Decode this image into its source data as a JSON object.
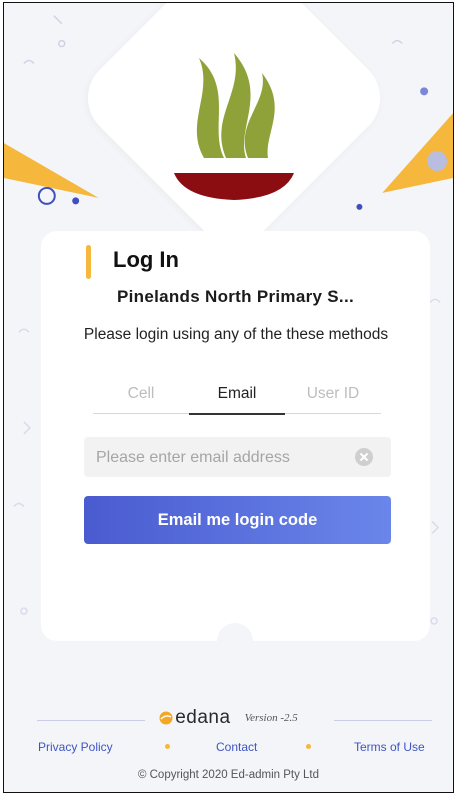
{
  "header": {
    "logo_icon": "school-flame-logo-icon",
    "colors": {
      "flame": "#8fa23a",
      "bowl": "#8b0d12"
    }
  },
  "card": {
    "title": "Log In",
    "school_name": "Pinelands North Primary S...",
    "instruction": "Please login using any of the these methods",
    "tabs": [
      {
        "label": "Cell",
        "active": false
      },
      {
        "label": "Email",
        "active": true
      },
      {
        "label": "User ID",
        "active": false
      }
    ],
    "email": {
      "value": "",
      "placeholder": "Please enter email address"
    },
    "submit_label": "Email me login code",
    "accent_color": "#5468d8"
  },
  "footer": {
    "brand": "edana",
    "version": "Version -2.5",
    "links": [
      "Privacy Policy",
      "Contact",
      "Terms of Use"
    ],
    "copyright": "© Copyright 2020 Ed-admin Pty Ltd",
    "link_color": "#3d55c4",
    "dot_color": "#f5b73c"
  }
}
